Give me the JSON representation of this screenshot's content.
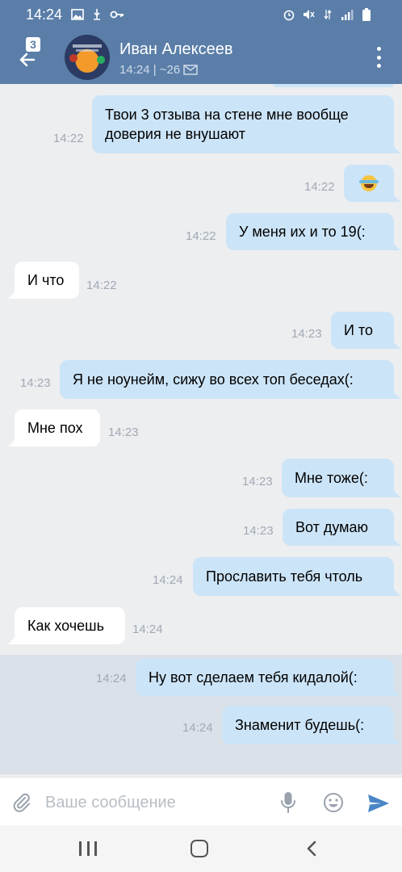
{
  "status_bar": {
    "time": "14:24",
    "icons": [
      "gallery-icon",
      "usb-icon",
      "key-icon",
      "alarm-icon",
      "mute-icon",
      "data-icon",
      "signal-icon",
      "battery-icon"
    ]
  },
  "header": {
    "unread_count": "3",
    "contact_name": "Иван Алексеев",
    "status": "14:24 | ~26"
  },
  "messages": [
    {
      "dir": "out",
      "text": "Твои 3 отзыва на стене мне вообще доверия не внушают",
      "time": "14:22"
    },
    {
      "dir": "out",
      "text": "",
      "emoji": "crying-laughing-emoji",
      "time": "14:22"
    },
    {
      "dir": "out",
      "text": "У меня их и то 19(:",
      "time": "14:22"
    },
    {
      "dir": "in",
      "text": "И что",
      "time": "14:22"
    },
    {
      "dir": "out",
      "text": "И то",
      "time": "14:23"
    },
    {
      "dir": "out",
      "text": "Я не ноунейм, сижу во всех топ беседах(:",
      "time": "14:23"
    },
    {
      "dir": "in",
      "text": "Мне пох",
      "time": "14:23"
    },
    {
      "dir": "out",
      "text": "Мне тоже(:",
      "time": "14:23"
    },
    {
      "dir": "out",
      "text": "Вот думаю",
      "time": "14:23"
    },
    {
      "dir": "out",
      "text": "Прославить тебя чтоль",
      "time": "14:24"
    },
    {
      "dir": "in",
      "text": "Как хочешь",
      "time": "14:24"
    },
    {
      "dir": "out",
      "text": "Ну вот сделаем тебя кидалой(:",
      "time": "14:24"
    },
    {
      "dir": "out",
      "text": "Знаменит будешь(:",
      "time": "14:24"
    }
  ],
  "composer": {
    "placeholder": "Ваше сообщение",
    "value": ""
  },
  "colors": {
    "header": "#5a7ea8",
    "outgoing_bubble": "#cce4f7",
    "incoming_bubble": "#ffffff",
    "background": "#edeef0",
    "accent": "#4a86c7"
  }
}
